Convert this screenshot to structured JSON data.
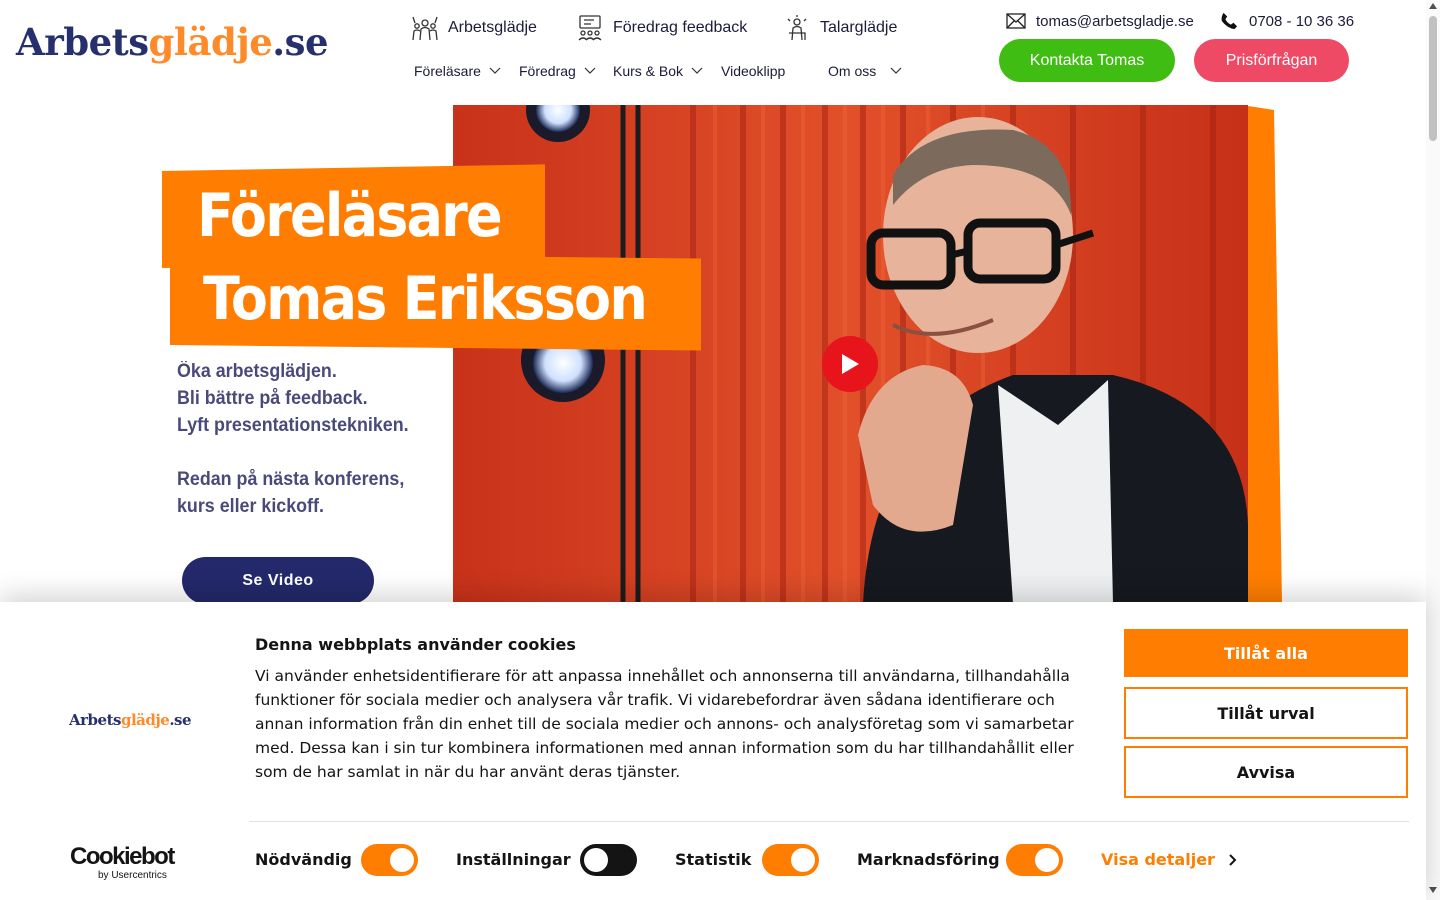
{
  "header": {
    "logo": {
      "part1": "Arbets",
      "part2": "glädje",
      "part3": ".se"
    },
    "top_nav": [
      {
        "label": "Arbetsglädje",
        "icon": "team-icon"
      },
      {
        "label": "Föredrag feedback",
        "icon": "presentation-icon"
      },
      {
        "label": "Talarglädje",
        "icon": "speaker-icon"
      }
    ],
    "sub_nav": [
      {
        "label": "Föreläsare",
        "has_dropdown": true
      },
      {
        "label": "Föredrag",
        "has_dropdown": true
      },
      {
        "label": "Kurs & Bok",
        "has_dropdown": true
      },
      {
        "label": "Videoklipp",
        "has_dropdown": false
      },
      {
        "label": "Om oss",
        "has_dropdown": true
      }
    ],
    "email": "tomas@arbetsgladje.se",
    "phone": "0708 - 10 36 36",
    "contact_button": "Kontakta Tomas",
    "quote_button": "Prisförfrågan"
  },
  "hero": {
    "title_line1": "Föreläsare",
    "title_line2": "Tomas Eriksson",
    "tagline": [
      "Öka arbetsglädjen.",
      "Bli bättre på feedback.",
      "Lyft presentationstekniken.",
      "Redan på nästa konferens,",
      "kurs eller kickoff."
    ],
    "video_button": "Se Video"
  },
  "cookie_banner": {
    "logo": {
      "part1": "Arbets",
      "part2": "glädje",
      "part3": ".se"
    },
    "title": "Denna webbplats använder cookies",
    "text": "Vi använder enhetsidentifierare för att anpassa innehållet och annonserna till användarna, tillhandahålla funktioner för sociala medier och analysera vår trafik. Vi vidarebefordrar även sådana identifierare och annan information från din enhet till de sociala medier och annons- och analysföretag som vi samarbetar med. Dessa kan i sin tur kombinera informationen med annan information som du har tillhandahållit eller som de har samlat in när du har använt deras tjänster.",
    "buttons": {
      "allow_all": "Tillåt alla",
      "allow_selection": "Tillåt urval",
      "deny": "Avvisa"
    },
    "toggles": [
      {
        "label": "Nödvändig",
        "checked": true
      },
      {
        "label": "Inställningar",
        "checked": false
      },
      {
        "label": "Statistik",
        "checked": true
      },
      {
        "label": "Marknadsföring",
        "checked": true
      }
    ],
    "details_link": "Visa detaljer",
    "powered_by": {
      "brand": "Cookiebot",
      "sub": "by Usercentrics"
    }
  },
  "colors": {
    "brand_navy": "#26306d",
    "brand_orange": "#ff7d00",
    "green": "#3fbd12",
    "pink": "#ee4a66",
    "play_red": "#e8141c"
  }
}
